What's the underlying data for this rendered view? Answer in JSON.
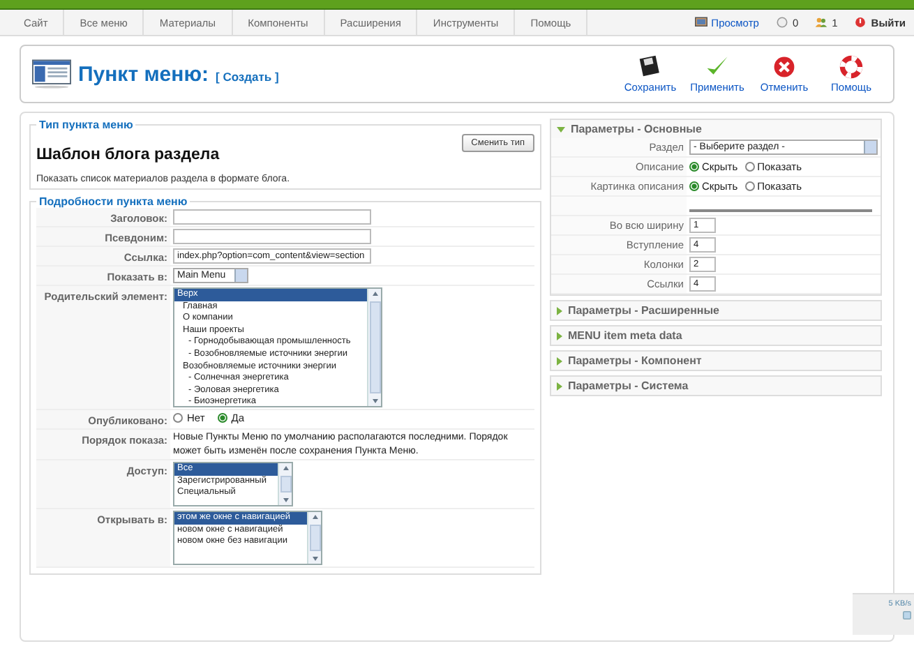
{
  "top_menu": [
    {
      "label": "Сайт"
    },
    {
      "label": "Все меню"
    },
    {
      "label": "Материалы"
    },
    {
      "label": "Компоненты"
    },
    {
      "label": "Расширения"
    },
    {
      "label": "Инструменты"
    },
    {
      "label": "Помощь"
    }
  ],
  "status": [
    {
      "kind": "preview",
      "label": "Просмотр"
    },
    {
      "kind": "messages",
      "label": "0"
    },
    {
      "kind": "users",
      "label": "1"
    },
    {
      "kind": "logout",
      "label": "Выйти"
    }
  ],
  "header": {
    "title": "Пункт меню:",
    "subtitle": "[ Создать ]"
  },
  "toolbar": [
    {
      "kind": "save",
      "label": "Сохранить"
    },
    {
      "kind": "apply",
      "label": "Применить"
    },
    {
      "kind": "cancel",
      "label": "Отменить"
    },
    {
      "kind": "help",
      "label": "Помощь"
    }
  ],
  "type_section": {
    "legend": "Тип пункта меню",
    "button": "Сменить тип",
    "name": "Шаблон блога раздела",
    "description": "Показать список материалов раздела в формате блога."
  },
  "details": {
    "legend": "Подробности пункта меню",
    "fields": [
      {
        "kind": "text",
        "label": "Заголовок:"
      },
      {
        "kind": "text",
        "label": "Псевдоним:"
      },
      {
        "kind": "text",
        "label": "Ссылка:",
        "value": "index.php?option=com_content&view=section"
      },
      {
        "kind": "select",
        "label": "Показать в:",
        "value": "Main Menu"
      },
      {
        "kind": "listbox",
        "label": "Родительский элемент:",
        "items": [
          {
            "label": "Верх",
            "selected": true,
            "children": [
              {
                "label": "Главная",
                "selected": false
              },
              {
                "label": "О компании",
                "selected": false
              },
              {
                "label": "Наши проекты",
                "selected": false,
                "children": [
                  {
                    "label": "- Горнодобывающая промышленность",
                    "selected": false
                  },
                  {
                    "label": "- Возобновляемые источники энергии",
                    "selected": false
                  }
                ]
              },
              {
                "label": "Возобновляемые источники энергии",
                "selected": false,
                "children": [
                  {
                    "label": "- Солнечная энергетика",
                    "selected": false
                  },
                  {
                    "label": "- Эоловая энергетика",
                    "selected": false
                  },
                  {
                    "label": "- Биоэнергетика",
                    "selected": false
                  }
                ]
              }
            ]
          }
        ]
      },
      {
        "kind": "radio",
        "label": "Опубликовано:",
        "options": [
          {
            "label": "Нет",
            "selected": false
          },
          {
            "label": "Да",
            "selected": true
          }
        ]
      },
      {
        "kind": "note",
        "label": "Порядок показа:",
        "text": "Новые Пункты Меню по умолчанию располагаются последними. Порядок может быть изменён после сохранения Пункта Меню."
      },
      {
        "kind": "listbox",
        "label": "Доступ:",
        "items": [
          {
            "label": "Все",
            "selected": true
          },
          {
            "label": "Зарегистрированный",
            "selected": false
          },
          {
            "label": "Специальный",
            "selected": false
          }
        ]
      },
      {
        "kind": "listbox",
        "label": "Открывать в:",
        "items": [
          {
            "label": "этом же окне с навигацией",
            "selected": true
          },
          {
            "label": "новом окне с навигацией",
            "selected": false
          },
          {
            "label": "новом окне без навигации",
            "selected": false
          }
        ]
      }
    ]
  },
  "panels": [
    {
      "title": "Параметры - Основные",
      "expanded": true,
      "rows": [
        {
          "kind": "select",
          "label": "Раздел",
          "value": "- Выберите раздел -"
        },
        {
          "kind": "radio",
          "label": "Описание",
          "options": [
            {
              "label": "Скрыть",
              "selected": true
            },
            {
              "label": "Показать",
              "selected": false
            }
          ]
        },
        {
          "kind": "radio",
          "label": "Картинка описания",
          "options": [
            {
              "label": "Скрыть",
              "selected": true
            },
            {
              "label": "Показать",
              "selected": false
            }
          ]
        },
        {
          "kind": "separator"
        },
        {
          "kind": "text",
          "label": "Во всю ширину",
          "value": "1"
        },
        {
          "kind": "text",
          "label": "Вступление",
          "value": "4"
        },
        {
          "kind": "text",
          "label": "Колонки",
          "value": "2"
        },
        {
          "kind": "text",
          "label": "Ссылки",
          "value": "4"
        }
      ]
    },
    {
      "title": "Параметры - Расширенные",
      "expanded": false
    },
    {
      "title": "MENU item meta data",
      "expanded": false
    },
    {
      "title": "Параметры - Компонент",
      "expanded": false
    },
    {
      "title": "Параметры - Система",
      "expanded": false
    }
  ],
  "net_meter": {
    "reading": "5 KB/s"
  }
}
